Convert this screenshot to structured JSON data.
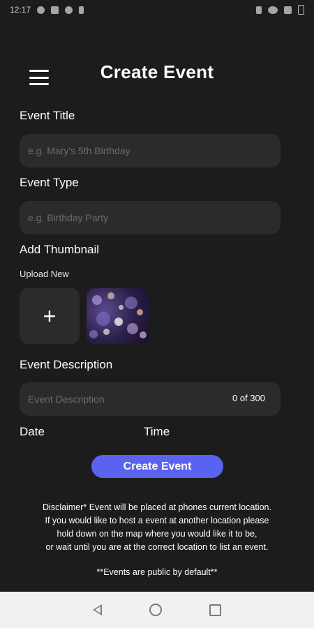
{
  "status_bar": {
    "time": "12:17",
    "left_icons": [
      "messenger-icon",
      "image-icon",
      "location-icon",
      "bolt-icon"
    ],
    "right_icons": [
      "bluetooth-icon",
      "wifi-icon",
      "signal-icon",
      "battery-icon"
    ]
  },
  "header": {
    "title": "Create Event",
    "menu_icon": "hamburger-menu-icon"
  },
  "form": {
    "title_label": "Event Title",
    "title_placeholder": "e.g. Mary's 5th Birthday",
    "type_label": "Event Type",
    "type_placeholder": "e.g. Birthday Party",
    "thumbnail_label": "Add Thumbnail",
    "upload_label": "Upload New",
    "upload_symbol": "+",
    "description_label": "Event Description",
    "description_placeholder": "Event Description",
    "description_counter": "0 of 300",
    "date_label": "Date",
    "time_label": "Time",
    "submit_label": "Create Event"
  },
  "footer": {
    "disclaimer_lines": [
      "Disclaimer* Event will be placed at phones current location.",
      "If you would like to host a event at another location please",
      "hold down on the map where you would like it to be,",
      "or wait until you are at the correct location to list an event."
    ],
    "public_note": "**Events are public by default**"
  },
  "nav_bar": {
    "icons": [
      "back-icon",
      "home-icon",
      "recent-apps-icon"
    ]
  },
  "colors": {
    "background": "#1c1c1c",
    "field": "#2b2b2b",
    "accent": "#5a63f0",
    "nav_bar": "#f1f1f1"
  }
}
